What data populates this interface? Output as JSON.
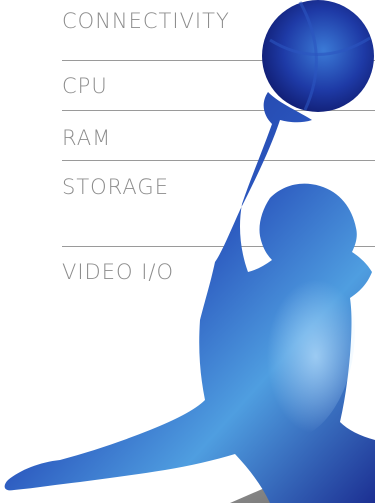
{
  "specs": {
    "items": [
      {
        "label": "CONNECTIVITY"
      },
      {
        "label": "CPU"
      },
      {
        "label": "RAM"
      },
      {
        "label": "STORAGE"
      },
      {
        "label": "VIDEO I/O"
      }
    ]
  },
  "colors": {
    "label_text": "#8c8c8c",
    "divider": "#9a9a9a",
    "silhouette_dark": "#1b2a8c",
    "silhouette_light": "#4f9ee0",
    "floor": "#8a8a8a"
  },
  "icons": {
    "athlete": "basketball-player-dunk-silhouette",
    "ball": "basketball-icon"
  }
}
